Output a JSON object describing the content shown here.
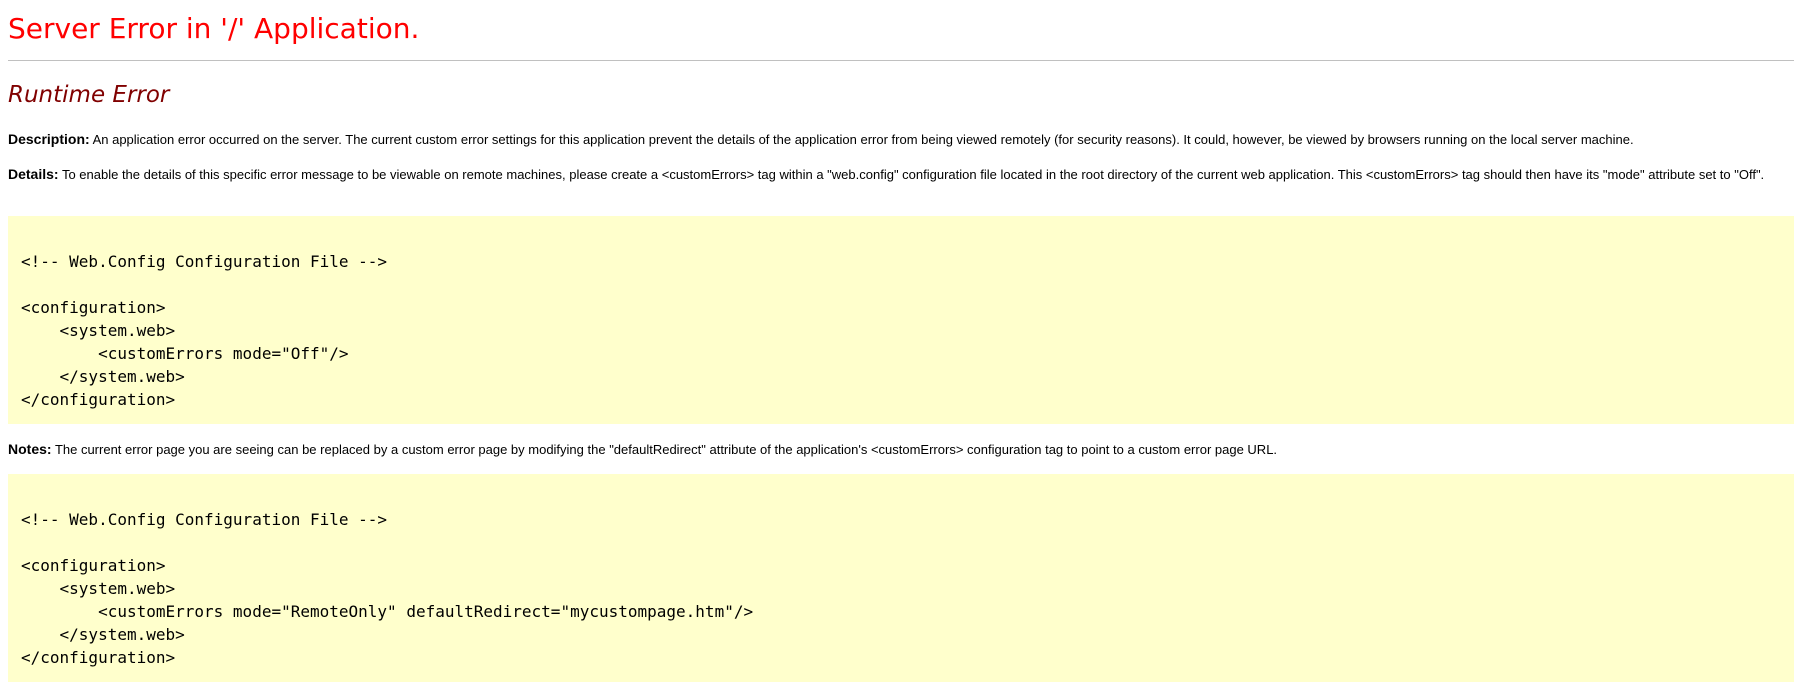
{
  "header": {
    "title": "Server Error in '/' Application.",
    "subtitle": "Runtime Error"
  },
  "description": {
    "label": "Description:",
    "text": " An application error occurred on the server. The current custom error settings for this application prevent the details of the application error from being viewed remotely (for security reasons). It could, however, be viewed by browsers running on the local server machine."
  },
  "details": {
    "label": "Details:",
    "text": " To enable the details of this specific error message to be viewable on remote machines, please create a <customErrors> tag within a \"web.config\" configuration file located in the root directory of the current web application. This <customErrors> tag should then have its \"mode\" attribute set to \"Off\"."
  },
  "code_block_1": {
    "lines": [
      "<!-- Web.Config Configuration File -->",
      "",
      "<configuration>",
      "    <system.web>",
      "        <customErrors mode=\"Off\"/>",
      "    </system.web>",
      "</configuration>"
    ]
  },
  "notes": {
    "label": "Notes:",
    "text": " The current error page you are seeing can be replaced by a custom error page by modifying the \"defaultRedirect\" attribute of the application's <customErrors> configuration tag to point to a custom error page URL."
  },
  "code_block_2": {
    "lines": [
      "<!-- Web.Config Configuration File -->",
      "",
      "<configuration>",
      "    <system.web>",
      "        <customErrors mode=\"RemoteOnly\" defaultRedirect=\"mycustompage.htm\"/>",
      "    </system.web>",
      "</configuration>"
    ]
  },
  "colors": {
    "title": "#ff0000",
    "subtitle": "#800000",
    "code_background": "#ffffcc",
    "rule": "#c0c0c0"
  }
}
